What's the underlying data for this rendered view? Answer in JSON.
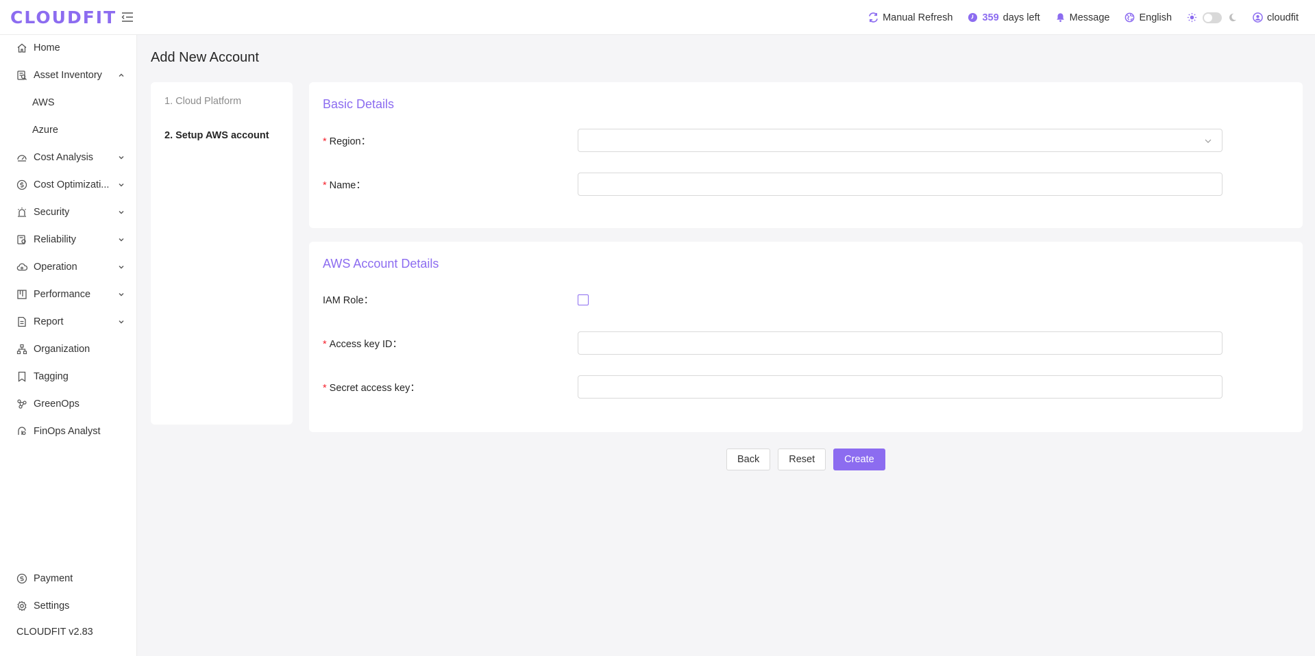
{
  "brand": {
    "logo": "CLOUDFIT",
    "accent": "#8c6cf0"
  },
  "header": {
    "refresh_label": "Manual Refresh",
    "days_count": "359",
    "days_label": "days left",
    "message_label": "Message",
    "language_label": "English",
    "username": "cloudfit"
  },
  "sidebar": {
    "items": [
      {
        "label": "Home",
        "icon": "home-icon"
      },
      {
        "label": "Asset Inventory",
        "icon": "inventory-icon",
        "expanded": true
      },
      {
        "label": "AWS"
      },
      {
        "label": "Azure"
      },
      {
        "label": "Cost Analysis",
        "icon": "gauge-icon"
      },
      {
        "label": "Cost Optimizati...",
        "icon": "dollar-icon"
      },
      {
        "label": "Security",
        "icon": "alarm-icon"
      },
      {
        "label": "Reliability",
        "icon": "reliability-icon"
      },
      {
        "label": "Operation",
        "icon": "cloud-icon"
      },
      {
        "label": "Performance",
        "icon": "board-icon"
      },
      {
        "label": "Report",
        "icon": "report-icon"
      },
      {
        "label": "Organization",
        "icon": "org-icon"
      },
      {
        "label": "Tagging",
        "icon": "tag-icon"
      },
      {
        "label": "GreenOps",
        "icon": "green-icon"
      },
      {
        "label": "FinOps Analyst",
        "icon": "analyst-icon"
      }
    ],
    "bottom": [
      {
        "label": "Payment",
        "icon": "payment-icon"
      },
      {
        "label": "Settings",
        "icon": "gear-icon"
      }
    ],
    "version": "CLOUDFIT v2.83"
  },
  "main": {
    "title": "Add New Account",
    "steps": [
      "1. Cloud Platform",
      "2. Setup AWS account"
    ],
    "basic": {
      "title": "Basic Details",
      "region_label": "Region：",
      "name_label": "Name："
    },
    "aws": {
      "title": "AWS Account Details",
      "iam_label": "IAM Role：",
      "access_label": "Access key ID：",
      "secret_label": "Secret access key："
    },
    "buttons": {
      "back": "Back",
      "reset": "Reset",
      "create": "Create"
    }
  }
}
